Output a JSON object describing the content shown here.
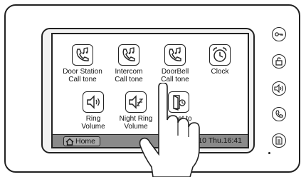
{
  "tiles": [
    {
      "label": "Door Station\nCall tone",
      "icon": "phone-music-icon"
    },
    {
      "label": "Intercom\nCall tone",
      "icon": "phone-music-icon"
    },
    {
      "label": "DoorBell\nCall tone",
      "icon": "phone-music-icon"
    },
    {
      "label": "Clock",
      "icon": "alarm-clock-icon"
    },
    {
      "label": "Ring\nVolume",
      "icon": "speaker-volume-icon"
    },
    {
      "label": "Night Ring\nVolume",
      "icon": "speaker-sleep-icon"
    },
    {
      "label": "Reset to\nDefault",
      "icon": "reset-door-icon"
    }
  ],
  "statusbar": {
    "home_label": "Home",
    "datetime": "0 2010 Thu.16:41"
  },
  "side_buttons": [
    "key-icon",
    "unlock-icon",
    "monitor-speaker-icon",
    "call-icon",
    "menu-icon"
  ]
}
